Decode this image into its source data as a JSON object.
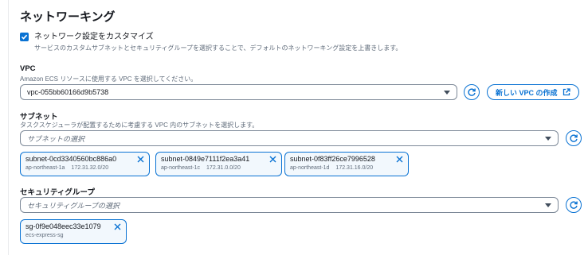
{
  "section": {
    "title": "ネットワーキング"
  },
  "customize": {
    "checked": true,
    "label": "ネットワーク設定をカスタマイズ",
    "description": "サービスのカスタムサブネットとセキュリティグループを選択することで、デフォルトのネットワーキング設定を上書きします。"
  },
  "vpc": {
    "label": "VPC",
    "description": "Amazon ECS リソースに使用する VPC を選択してください。",
    "selected": "vpc-055bb60166d9b5738",
    "create_label": "新しい VPC の作成"
  },
  "subnets": {
    "label": "サブネット",
    "description": "タスクスケジューラが配置するために考慮する VPC 内のサブネットを選択します。",
    "placeholder": "サブネットの選択",
    "tokens": [
      {
        "id": "subnet-0cd3340560bc886a0",
        "az": "ap-northeast-1a",
        "cidr": "172.31.32.0/20"
      },
      {
        "id": "subnet-0849e7111f2ea3a41",
        "az": "ap-northeast-1c",
        "cidr": "172.31.0.0/20"
      },
      {
        "id": "subnet-0f83ff26ce7996528",
        "az": "ap-northeast-1d",
        "cidr": "172.31.16.0/20"
      }
    ]
  },
  "security_groups": {
    "label": "セキュリティグループ",
    "placeholder": "セキュリティグループの選択",
    "tokens": [
      {
        "id": "sg-0f9e048eec33e1079",
        "name": "ecs-express-sg"
      }
    ]
  },
  "colors": {
    "accent": "#0972d3",
    "token_bg": "#f2f8fd",
    "text": "#16191f",
    "muted": "#5f6b7a"
  }
}
